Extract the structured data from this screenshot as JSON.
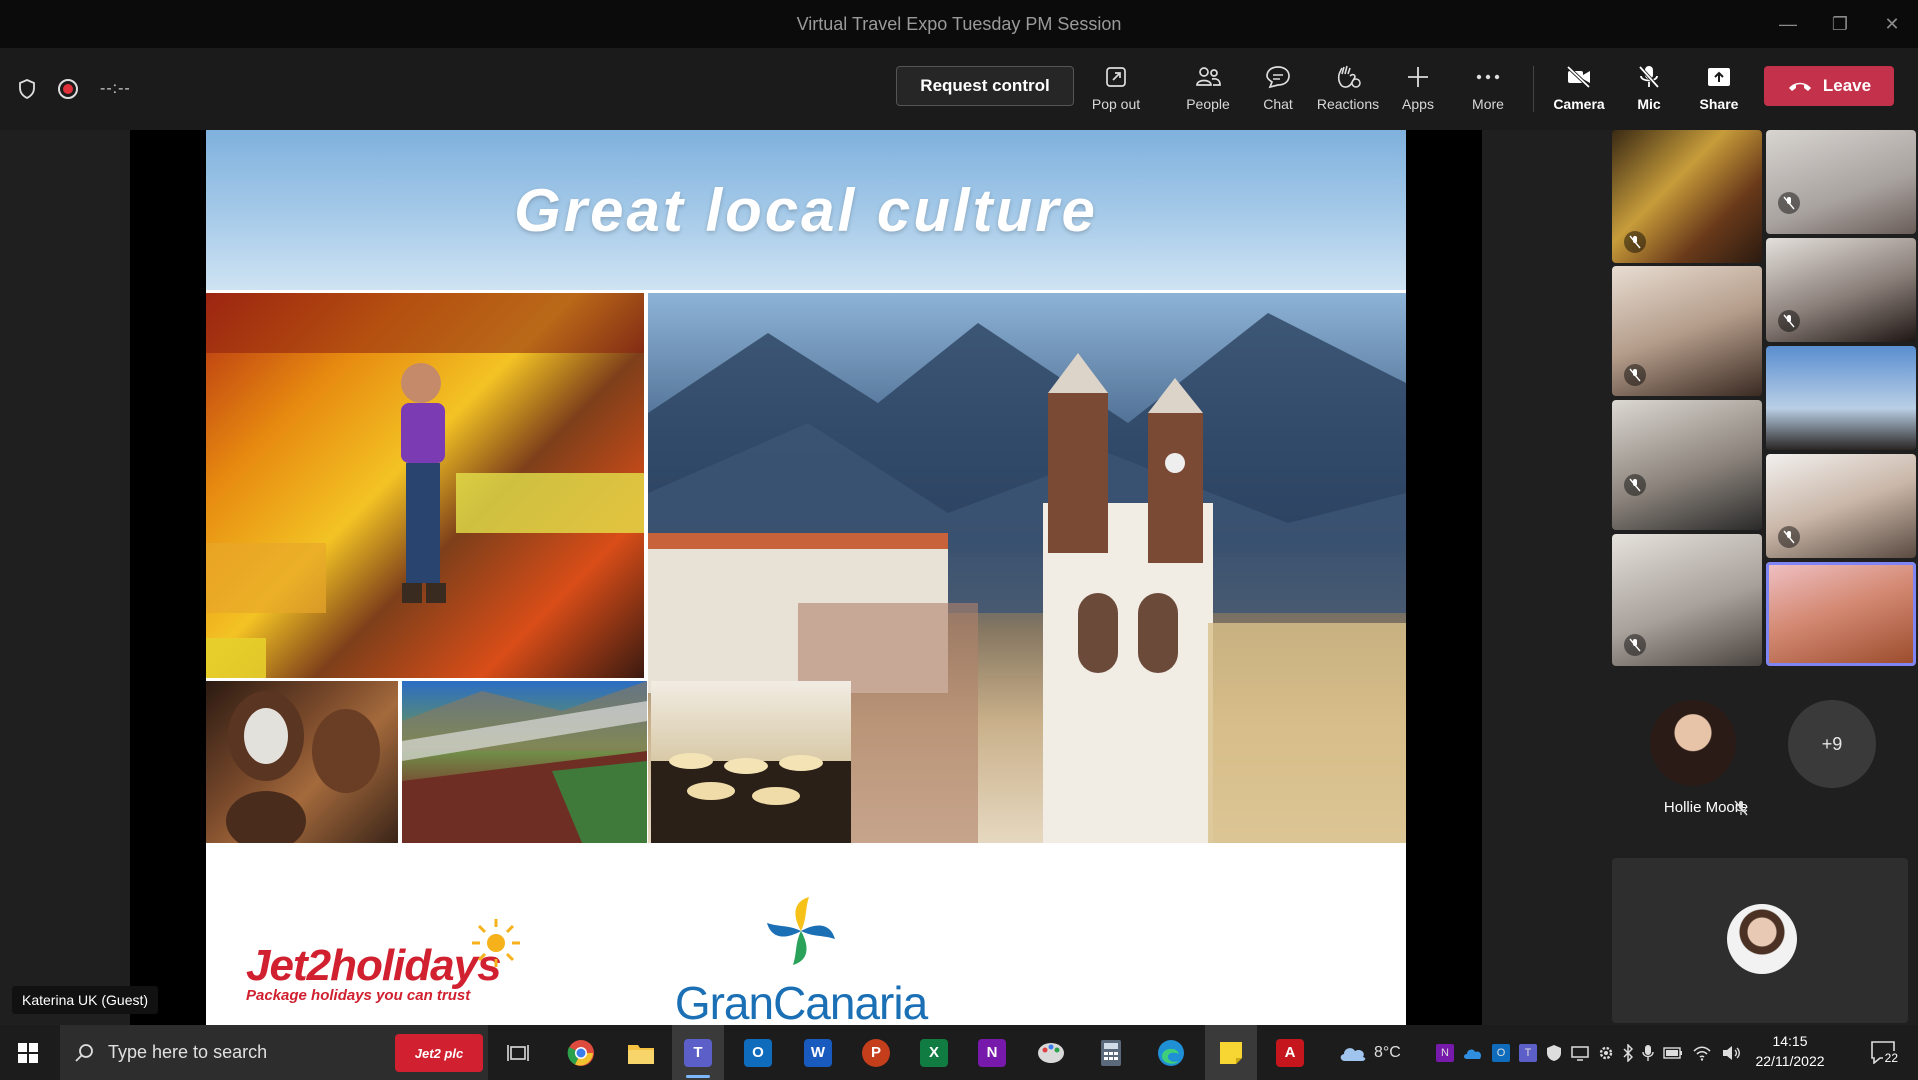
{
  "window": {
    "title": "Virtual Travel Expo Tuesday PM Session"
  },
  "toolbar": {
    "timer": "--:--",
    "request_control": "Request control",
    "items": [
      {
        "label": "Pop out",
        "icon": "pop-out-icon"
      },
      {
        "label": "People",
        "icon": "people-icon"
      },
      {
        "label": "Chat",
        "icon": "chat-icon"
      },
      {
        "label": "Reactions",
        "icon": "reactions-icon"
      },
      {
        "label": "Apps",
        "icon": "plus-icon"
      },
      {
        "label": "More",
        "icon": "ellipsis-icon"
      },
      {
        "label": "Camera",
        "icon": "camera-off-icon"
      },
      {
        "label": "Mic",
        "icon": "mic-off-icon"
      },
      {
        "label": "Share",
        "icon": "share-icon"
      }
    ],
    "leave": "Leave"
  },
  "slide": {
    "heading": "Great local culture",
    "jet2_brand": "Jet2holidays",
    "jet2_tagline": "Package holidays you can trust",
    "gc_name": "GranCanaria"
  },
  "presenter": {
    "name_tag": "Katerina UK (Guest)"
  },
  "participants": {
    "featured_name": "Hollie Moore",
    "more_count": "+9"
  },
  "taskbar": {
    "search_placeholder": "Type here to search",
    "search_badge": "Jet2 plc",
    "weather": "8°C",
    "time": "14:15",
    "date": "22/11/2022",
    "notifications": "22"
  },
  "colors": {
    "leave": "#c4314b",
    "accent": "#7f85f5",
    "jet2_red": "#d1202f",
    "gc_blue": "#1a6fb5"
  }
}
